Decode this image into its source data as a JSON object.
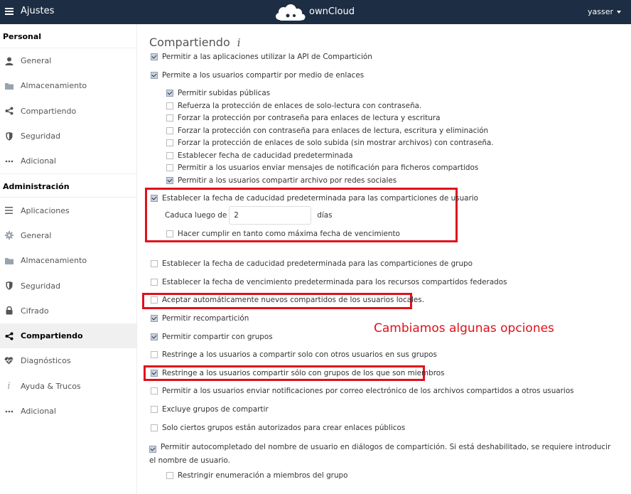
{
  "header": {
    "app_title": "Ajustes",
    "logo_text": "ownCloud",
    "user": "yasser"
  },
  "sidebar": {
    "personal_heading": "Personal",
    "personal_items": [
      {
        "label": "General",
        "icon": "user-icon"
      },
      {
        "label": "Almacenamiento",
        "icon": "folder-icon"
      },
      {
        "label": "Compartiendo",
        "icon": "share-icon"
      },
      {
        "label": "Seguridad",
        "icon": "shield-icon"
      },
      {
        "label": "Adicional",
        "icon": "more-icon"
      }
    ],
    "admin_heading": "Administración",
    "admin_items": [
      {
        "label": "Aplicaciones",
        "icon": "list-icon"
      },
      {
        "label": "General",
        "icon": "gear-icon"
      },
      {
        "label": "Almacenamiento",
        "icon": "folder-icon"
      },
      {
        "label": "Seguridad",
        "icon": "shield-icon"
      },
      {
        "label": "Cifrado",
        "icon": "lock-icon"
      },
      {
        "label": "Compartiendo",
        "icon": "share-icon",
        "active": true
      },
      {
        "label": "Diagnósticos",
        "icon": "pulse-heart-icon"
      },
      {
        "label": "Ayuda & Trucos",
        "icon": "info-icon"
      },
      {
        "label": "Adicional",
        "icon": "more-icon"
      }
    ]
  },
  "main": {
    "title": "Compartiendo",
    "info_glyph": "i",
    "options": [
      {
        "label": "Permitir a las aplicaciones utilizar la API de Compartición",
        "checked": true
      },
      {
        "label": "Permite a los usuarios compartir por medio de enlaces",
        "checked": true
      },
      {
        "label": "Permitir subidas públicas",
        "checked": true
      },
      {
        "label": "Refuerza la protección de enlaces de solo-lectura con contraseña.",
        "checked": false
      },
      {
        "label": "Forzar la protección por contraseña para enlaces de lectura y escritura",
        "checked": false
      },
      {
        "label": "Forzar la protección con contraseña para enlaces de lectura, escritura y eliminación",
        "checked": false
      },
      {
        "label": "Forzar la protección de enlaces de solo subida (sin mostrar archivos) con contraseña.",
        "checked": false
      },
      {
        "label": "Establecer fecha de caducidad predeterminada",
        "checked": false
      },
      {
        "label": "Permitir a los usuarios enviar mensajes de notificación para ficheros compartidos",
        "checked": false
      },
      {
        "label": "Permitir a los usuarios compartir archivo por redes sociales",
        "checked": true
      },
      {
        "label": "Establecer la fecha de caducidad predeterminada para las comparticiones de usuario",
        "checked": true
      },
      {
        "label": "Hacer cumplir en tanto como máxima fecha de vencimiento",
        "checked": false
      },
      {
        "label": "Establecer la fecha de caducidad predeterminada para las comparticiones de grupo",
        "checked": false
      },
      {
        "label": "Establecer la fecha de vencimiento predeterminada para los recursos compartidos federados",
        "checked": false
      },
      {
        "label": "Aceptar automáticamente nuevos compartidos de los usuarios locales.",
        "checked": false
      },
      {
        "label": "Permitir recompartición",
        "checked": true
      },
      {
        "label": "Permitir compartir con grupos",
        "checked": true
      },
      {
        "label": "Restringe a los usuarios a compartir solo con otros usuarios en sus grupos",
        "checked": false
      },
      {
        "label": "Restringe a los usuarios compartir sólo con grupos de los que son miembros",
        "checked": true
      },
      {
        "label": "Permitir a los usuarios enviar notificaciones por correo electrónico de los archivos compartidos a otros usuarios",
        "checked": false
      },
      {
        "label": "Excluye grupos de compartir",
        "checked": false
      },
      {
        "label": "Solo ciertos grupos están autorizados para crear enlaces públicos",
        "checked": false
      },
      {
        "label": "Permitir autocompletado del nombre de usuario en diálogos de compartición. Si está deshabilitado, se requiere introducir el nombre de usuario.",
        "checked": true
      },
      {
        "label": "Restringir enumeración a miembros del grupo",
        "checked": false
      }
    ],
    "expire": {
      "prefix": "Caduca luego de",
      "value": "2",
      "suffix": "días"
    },
    "annotation": "Cambiamos algunas opciones"
  },
  "colors": {
    "header_bg": "#1d2d44",
    "highlight_red": "#e0101a",
    "active_nav_bg": "#f0f0f0"
  }
}
